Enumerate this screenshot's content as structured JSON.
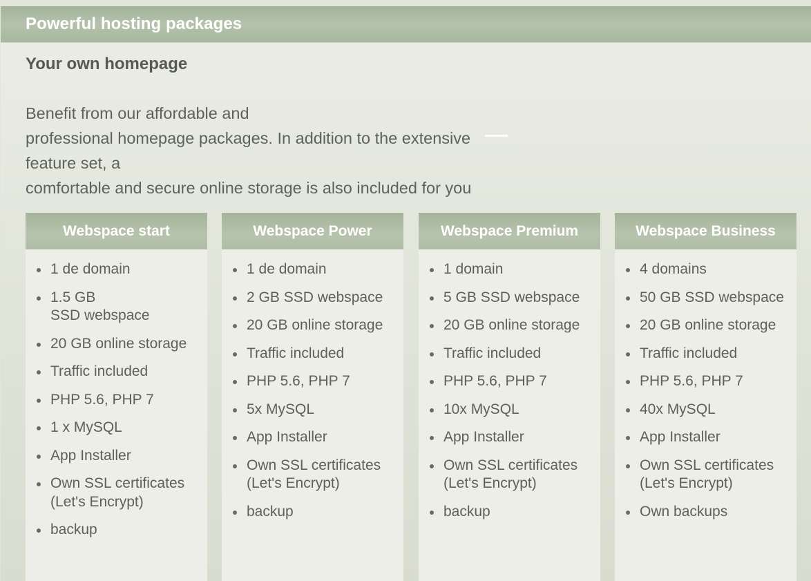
{
  "header": {
    "title": "Powerful hosting packages"
  },
  "subtitle": "Your own homepage",
  "intro": {
    "lines": [
      "Benefit from our affordable and",
      "professional homepage packages. In addition to the extensive",
      "feature set, a",
      "comfortable and secure online storage is also included for you"
    ]
  },
  "plans": [
    {
      "name": "Webspace start",
      "features": [
        "1 de domain",
        "1.5 GB\nSSD webspace",
        "20 GB online storage",
        "Traffic included",
        "PHP 5.6, PHP 7",
        "1 x MySQL",
        "App Installer",
        "Own SSL certificates (Let's Encrypt)",
        "backup"
      ]
    },
    {
      "name": "Webspace Power",
      "features": [
        "1 de domain",
        "2 GB SSD webspace",
        "20 GB online storage",
        "Traffic included",
        "PHP 5.6, PHP 7",
        "5x MySQL",
        "App Installer",
        "Own SSL certificates (Let's Encrypt)",
        "backup"
      ]
    },
    {
      "name": "Webspace Premium",
      "features": [
        "1 domain",
        "5 GB SSD webspace",
        "20 GB online storage",
        "Traffic included",
        "PHP 5.6, PHP 7",
        "10x MySQL",
        "App Installer",
        "Own SSL certificates (Let's Encrypt)",
        "backup"
      ]
    },
    {
      "name": "Webspace Business",
      "features": [
        "4 domains",
        "50 GB SSD webspace",
        "20 GB online storage",
        "Traffic included",
        "PHP 5.6, PHP 7",
        "40x MySQL",
        "App Installer",
        "Own SSL certificates (Let's Encrypt)",
        "Own backups"
      ]
    }
  ]
}
